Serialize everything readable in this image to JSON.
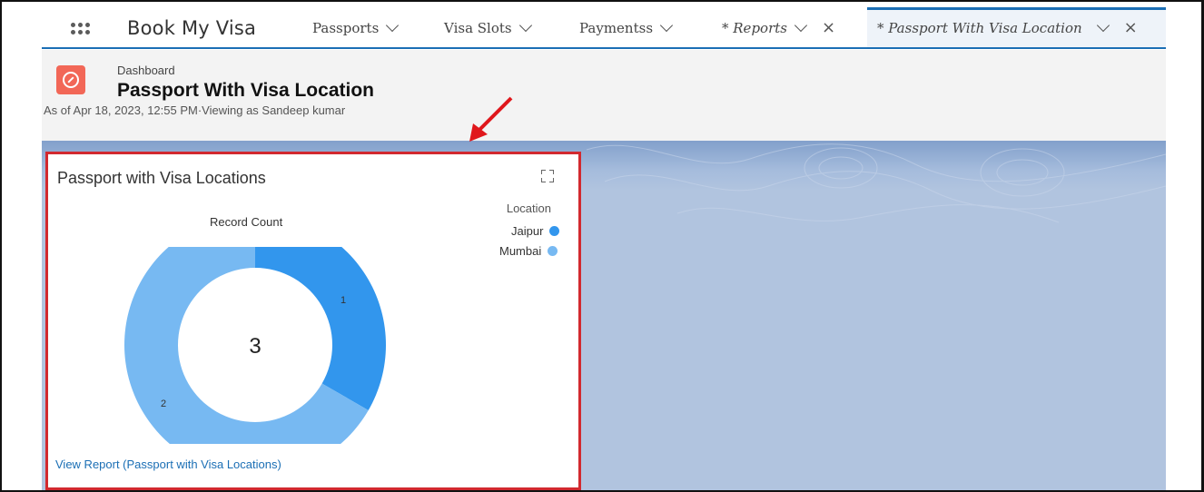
{
  "app": {
    "name": "Book My Visa"
  },
  "nav": {
    "items": [
      {
        "label": "Passports",
        "italic": false,
        "closable": false
      },
      {
        "label": "Visa Slots",
        "italic": false,
        "closable": false
      },
      {
        "label": "Paymentss",
        "italic": false,
        "closable": false
      },
      {
        "label": "* Reports",
        "italic": true,
        "closable": true
      },
      {
        "label": "* Passport With Visa Location",
        "italic": true,
        "closable": true,
        "active": true
      }
    ]
  },
  "header": {
    "breadcrumb": "Dashboard",
    "title": "Passport With Visa Location",
    "as_of": "As of Apr 18, 2023, 12:55 PM·Viewing as Sandeep kumar"
  },
  "widget": {
    "title": "Passport with Visa Locations",
    "chart_label": "Record Count",
    "legend_title": "Location",
    "view_report": "View Report (Passport with Visa Locations)"
  },
  "chart_data": {
    "type": "pie",
    "donut": true,
    "total": 3,
    "categories": [
      "Jaipur",
      "Mumbai"
    ],
    "values": [
      1,
      2
    ],
    "colors": [
      "#3296ed",
      "#77b9f2"
    ],
    "legend_title": "Location",
    "label": "Record Count"
  },
  "colors": {
    "accent": "#1b6fb5",
    "highlight_border": "#d2292f",
    "dashboard_icon": "#f26757",
    "canvas_bg": "#b1c4df"
  }
}
